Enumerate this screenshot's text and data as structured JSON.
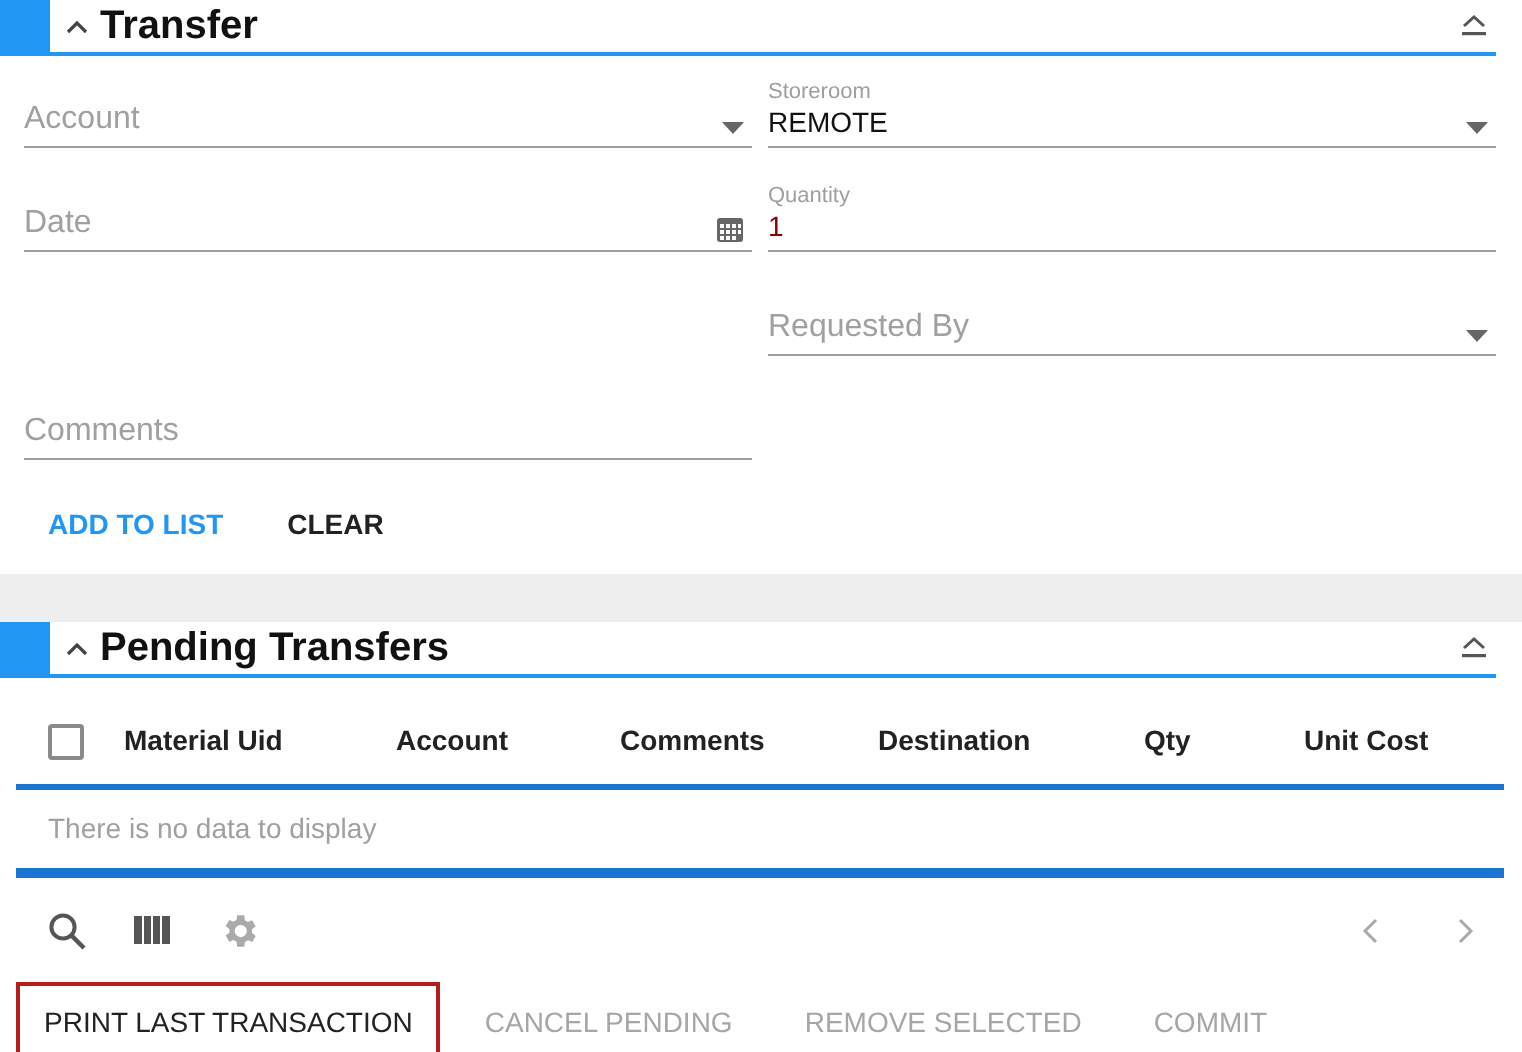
{
  "transfer": {
    "title": "Transfer",
    "form_rows": [
      {
        "left": {
          "label": "Account",
          "kind": "select",
          "invalid": false
        },
        "right": {
          "label": "Storeroom",
          "value": "REMOTE",
          "kind": "select",
          "invalid": false
        }
      },
      {
        "left": {
          "label": "Date",
          "kind": "date",
          "invalid": false
        },
        "right": {
          "label": "Quantity",
          "value": "1",
          "kind": "text",
          "invalid": true
        }
      },
      {
        "right": {
          "label": "Requested By",
          "kind": "select",
          "invalid": false
        }
      },
      {
        "left": {
          "label": "Comments",
          "kind": "text",
          "invalid": false
        }
      }
    ],
    "buttons": [
      {
        "label": "ADD TO LIST",
        "kind": "primary"
      },
      {
        "label": "CLEAR",
        "kind": "plain"
      }
    ]
  },
  "pending": {
    "title": "Pending Transfers",
    "select_all": {
      "checked": false
    },
    "columns": [
      "Material Uid",
      "Account",
      "Comments",
      "Destination",
      "Qty",
      "Unit Cost"
    ],
    "empty_message": "There is no data to display",
    "buttons": [
      {
        "label": "PRINT LAST TRANSACTION",
        "disabled": false,
        "focused": true
      },
      {
        "label": "CANCEL PENDING",
        "disabled": true,
        "focused": false
      },
      {
        "label": "REMOVE SELECTED",
        "disabled": true,
        "focused": false
      },
      {
        "label": "COMMIT",
        "disabled": true,
        "focused": false
      }
    ]
  }
}
